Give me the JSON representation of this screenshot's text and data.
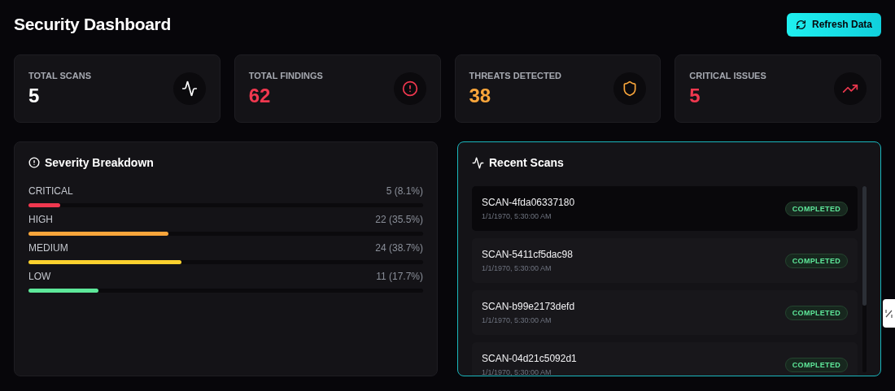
{
  "title": "Security Dashboard",
  "refresh_button": {
    "label": "Refresh Data"
  },
  "stats": [
    {
      "label": "TOTAL SCANS",
      "value": "5",
      "kind": "activity",
      "color": "#ffffff"
    },
    {
      "label": "TOTAL FINDINGS",
      "value": "62",
      "kind": "alert",
      "color": "#f0384f"
    },
    {
      "label": "THREATS DETECTED",
      "value": "38",
      "kind": "shield",
      "color": "#f9a53b"
    },
    {
      "label": "CRITICAL ISSUES",
      "value": "5",
      "kind": "trend",
      "color": "#f0384f"
    }
  ],
  "severity": {
    "title": "Severity Breakdown",
    "items": [
      {
        "label": "CRITICAL",
        "reading": "5 (8.1%)",
        "level": 0.081,
        "color": "#f0384f"
      },
      {
        "label": "HIGH",
        "reading": "22 (35.5%)",
        "level": 0.355,
        "color": "#f9a53b"
      },
      {
        "label": "MEDIUM",
        "reading": "24 (38.7%)",
        "level": 0.387,
        "color": "#fcd12e"
      },
      {
        "label": "LOW",
        "reading": "11 (17.7%)",
        "level": 0.177,
        "color": "#5ee89a"
      }
    ]
  },
  "recent_scans": {
    "title": "Recent Scans",
    "items": [
      {
        "id": "SCAN-4fda06337180",
        "time": "1/1/1970, 5:30:00 AM",
        "status": "COMPLETED",
        "selected": true
      },
      {
        "id": "SCAN-5411cf5dac98",
        "time": "1/1/1970, 5:30:00 AM",
        "status": "COMPLETED",
        "selected": false
      },
      {
        "id": "SCAN-b99e2173defd",
        "time": "1/1/1970, 5:30:00 AM",
        "status": "COMPLETED",
        "selected": false
      },
      {
        "id": "SCAN-04d21c5092d1",
        "time": "1/1/1970, 5:30:00 AM",
        "status": "COMPLETED",
        "selected": false
      }
    ]
  }
}
